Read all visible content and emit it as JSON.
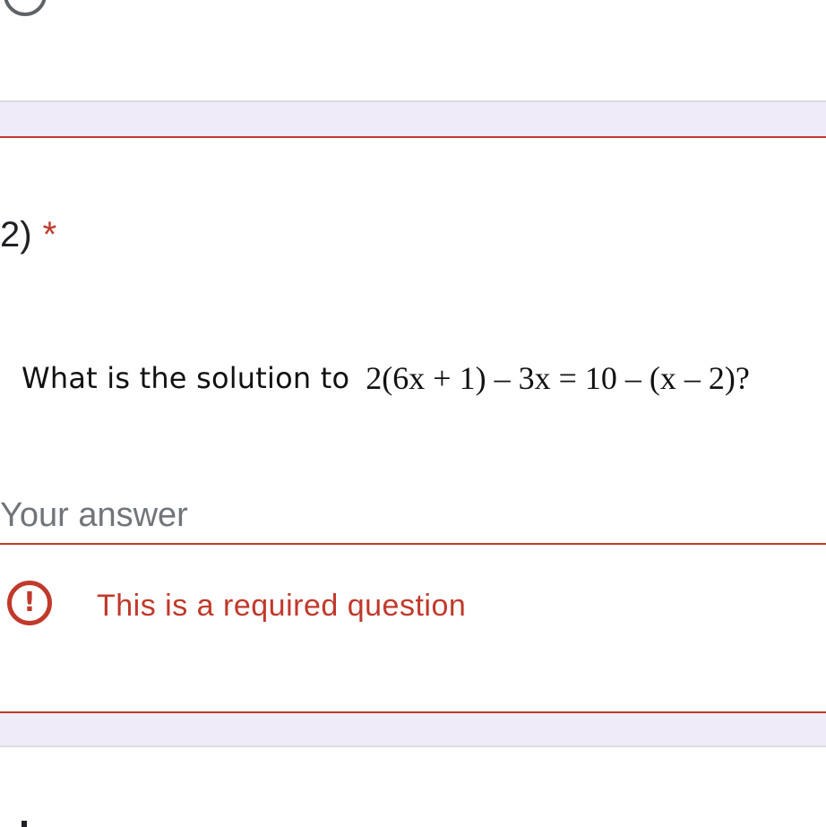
{
  "question": {
    "number_label": "2)",
    "required_marker": "*",
    "prompt": "What is the solution to",
    "equation": "2(6x + 1) – 3x = 10 – (x – 2)?"
  },
  "answer": {
    "placeholder": "Your answer",
    "value": ""
  },
  "validation": {
    "icon": "exclamation-icon",
    "message": "This is a required question"
  },
  "colors": {
    "error": "#c0392b",
    "background_band": "#f0ebf8",
    "text": "#202124",
    "placeholder": "#70757a"
  }
}
